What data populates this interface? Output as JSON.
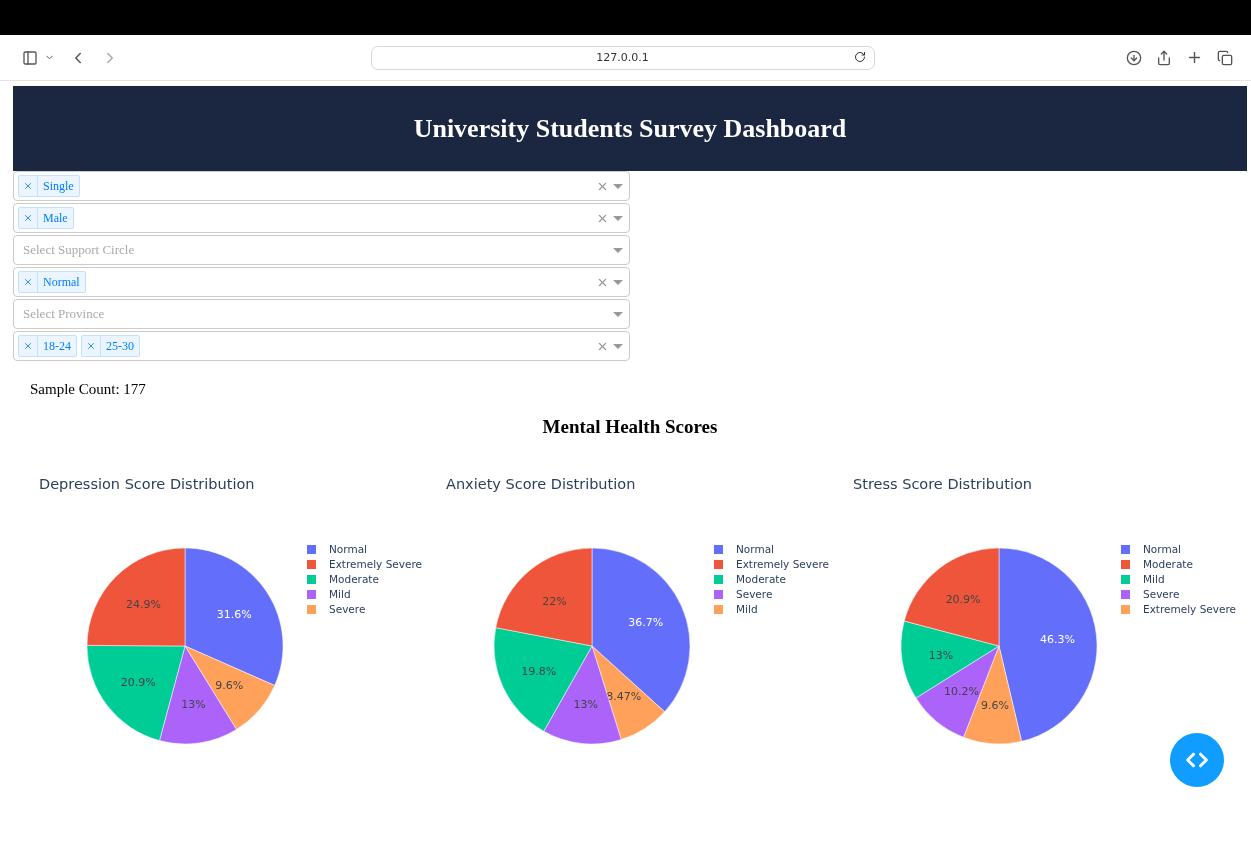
{
  "browser": {
    "url": "127.0.0.1"
  },
  "header": {
    "title": "University Students Survey Dashboard"
  },
  "filters": [
    {
      "kind": "tags",
      "tags": [
        "Single"
      ]
    },
    {
      "kind": "tags",
      "tags": [
        "Male"
      ]
    },
    {
      "kind": "empty",
      "placeholder": "Select Support Circle"
    },
    {
      "kind": "tags",
      "tags": [
        "Normal"
      ]
    },
    {
      "kind": "empty",
      "placeholder": "Select Province"
    },
    {
      "kind": "tags",
      "tags": [
        "18-24",
        "25-30"
      ]
    }
  ],
  "sample_count": "Sample Count: 177",
  "section_title": "Mental Health Scores",
  "charts": [
    {
      "title": "Depression Score Distribution",
      "chart_data": {
        "type": "pie",
        "categories": [
          "Normal",
          "Extremely Severe",
          "Moderate",
          "Mild",
          "Severe"
        ],
        "values": [
          31.6,
          24.9,
          20.9,
          13,
          9.6
        ],
        "colors": [
          "#636efa",
          "#ef553b",
          "#00cc96",
          "#ab63fa",
          "#ffa15a"
        ],
        "value_labels": [
          "31.6%",
          "24.9%",
          "20.9%",
          "13%",
          "9.6%"
        ]
      }
    },
    {
      "title": "Anxiety Score Distribution",
      "chart_data": {
        "type": "pie",
        "categories": [
          "Normal",
          "Extremely Severe",
          "Moderate",
          "Severe",
          "Mild"
        ],
        "values": [
          36.7,
          22,
          19.8,
          13,
          8.47
        ],
        "colors": [
          "#636efa",
          "#ef553b",
          "#00cc96",
          "#ab63fa",
          "#ffa15a"
        ],
        "value_labels": [
          "36.7%",
          "22%",
          "19.8%",
          "13%",
          "8.47%"
        ]
      }
    },
    {
      "title": "Stress Score Distribution",
      "chart_data": {
        "type": "pie",
        "categories": [
          "Normal",
          "Moderate",
          "Mild",
          "Severe",
          "Extremely Severe"
        ],
        "values": [
          46.3,
          20.9,
          13,
          10.2,
          9.6
        ],
        "colors": [
          "#636efa",
          "#ef553b",
          "#00cc96",
          "#ab63fa",
          "#ffa15a"
        ],
        "value_labels": [
          "46.3%",
          "20.9%",
          "13%",
          "10.2%",
          "9.6%"
        ]
      }
    }
  ]
}
